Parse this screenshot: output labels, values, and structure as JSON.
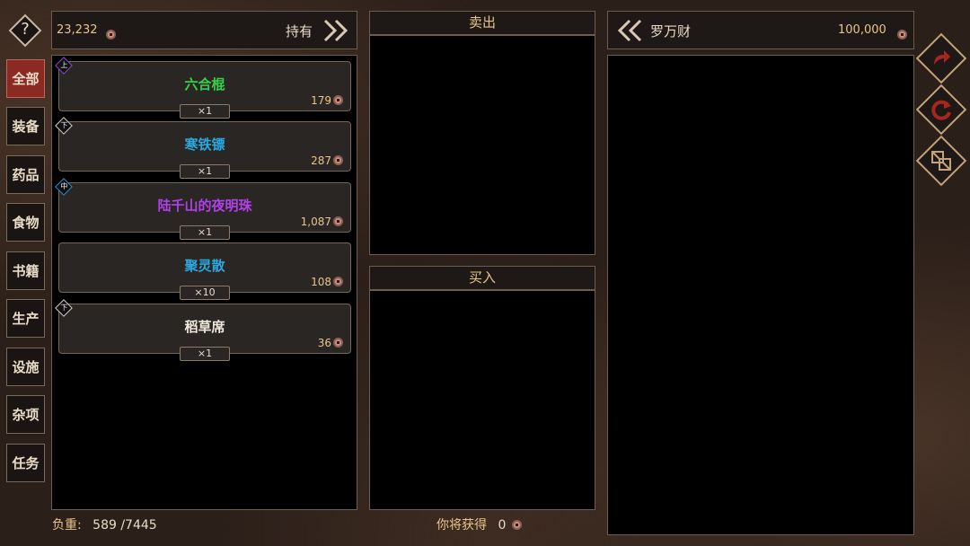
{
  "help_icon": "question-mark",
  "left_header": {
    "money": "23,232",
    "label": "持有"
  },
  "categories": [
    "全部",
    "装备",
    "药品",
    "食物",
    "书籍",
    "生产",
    "设施",
    "杂项",
    "任务"
  ],
  "items": [
    {
      "name": "六合棍",
      "price": "179",
      "qty": "×1",
      "color": "#35d04a",
      "badge": "上",
      "badge_color": "#8a4ad0"
    },
    {
      "name": "寒铁镖",
      "price": "287",
      "qty": "×1",
      "color": "#2aa8e0",
      "badge": "下",
      "badge_color": "#d8d0c4"
    },
    {
      "name": "陆千山的夜明珠",
      "price": "1,087",
      "qty": "×1",
      "color": "#b040e8",
      "badge": "中",
      "badge_color": "#2a90d0"
    },
    {
      "name": "聚灵散",
      "price": "108",
      "qty": "×10",
      "color": "#2aa8e0",
      "badge": "",
      "badge_color": ""
    },
    {
      "name": "稻草席",
      "price": "36",
      "qty": "×1",
      "color": "#f0e8dc",
      "badge": "下",
      "badge_color": "#d8d0c4"
    }
  ],
  "sell_title": "卖出",
  "buy_title": "买入",
  "merchant": {
    "name": "罗万财",
    "money": "100,000"
  },
  "footer": {
    "weight_label": "负重:",
    "weight_value": "589 /7445",
    "earn_label": "你将获得",
    "earn_value": "0"
  },
  "right_buttons": [
    "arrow-redo-icon",
    "refresh-icon",
    "swap-icon"
  ]
}
